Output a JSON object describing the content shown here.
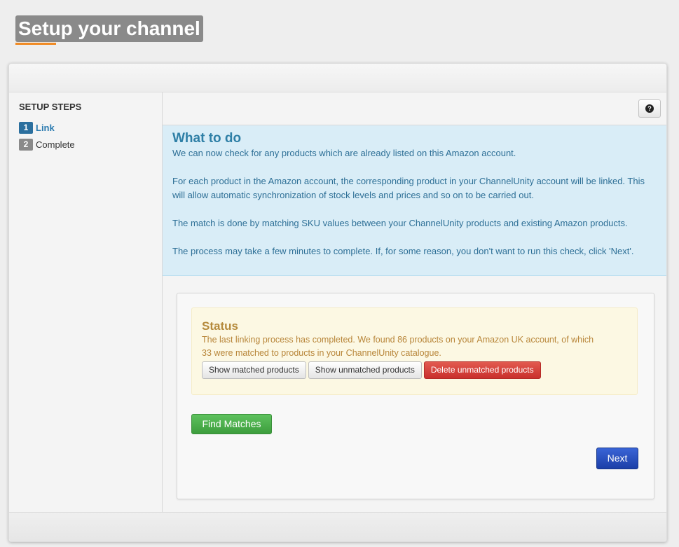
{
  "page": {
    "title": "Setup your channel"
  },
  "sidebar": {
    "heading": "SETUP STEPS",
    "steps": [
      {
        "number": "1",
        "label": "Link",
        "active": true
      },
      {
        "number": "2",
        "label": "Complete",
        "active": false
      }
    ]
  },
  "help": {
    "icon": "question-circle-icon",
    "glyph": "?"
  },
  "info": {
    "title": "What to do",
    "paragraphs": [
      "We can now check for any products which are already listed on this Amazon account.",
      "For each product in the Amazon account, the corresponding product in your ChannelUnity account will be linked. This will allow automatic synchronization of stock levels and prices and so on to be carried out.",
      "The match is done by matching SKU values between your ChannelUnity products and existing Amazon products.",
      "The process may take a few minutes to complete. If, for some reason, you don't want to run this check, click 'Next'."
    ]
  },
  "status": {
    "title": "Status",
    "text": "The last linking process has completed. We found 86 products on your Amazon UK account, of which 33 were matched to products in your ChannelUnity catalogue.",
    "buttons": {
      "show_matched": "Show matched products",
      "show_unmatched": "Show unmatched products",
      "delete_unmatched": "Delete unmatched products"
    }
  },
  "actions": {
    "find_matches": "Find Matches",
    "next": "Next"
  },
  "colors": {
    "active_step": "#2b7bb0",
    "inactive_step": "#8a8a8a",
    "title_underline": "#f08a24"
  }
}
